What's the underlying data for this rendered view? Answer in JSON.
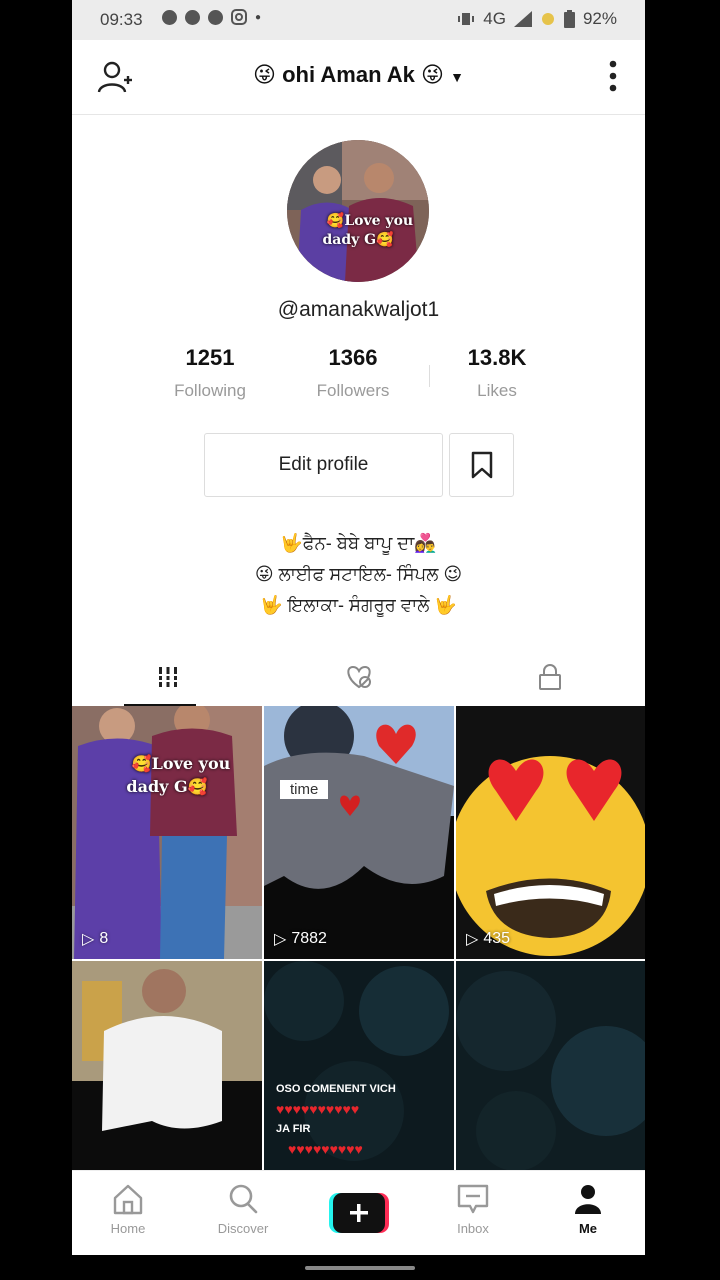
{
  "status_bar": {
    "time": "09:33",
    "network": "4G",
    "battery": "92%"
  },
  "header": {
    "title_prefix": "😜",
    "title": "ohi Aman Ak",
    "title_suffix": "😜"
  },
  "profile": {
    "avatar_caption_line1": "🥰Love you",
    "avatar_caption_line2": "dady G🥰",
    "handle": "@amanakwaljot1",
    "stats": [
      {
        "value": "1251",
        "label": "Following"
      },
      {
        "value": "1366",
        "label": "Followers"
      },
      {
        "value": "13.8K",
        "label": "Likes"
      }
    ],
    "edit_label": "Edit profile",
    "bio": [
      "🤟ਫੈਨ- ਬੇਬੇ ਬਾਪੂ ਦਾ👩‍❤️‍👨",
      "😜 ਲਾਈਫ ਸਟਾਇਲ- ਸਿੰਪਲ 😉",
      "🤟 ਇਲਾਕਾ- ਸੰਗਰੂਰ ਵਾਲੇ 🤟"
    ]
  },
  "tabs": [
    {
      "icon": "grid-icon"
    },
    {
      "icon": "liked-hidden-icon"
    },
    {
      "icon": "lock-icon"
    }
  ],
  "videos": [
    {
      "plays": "8",
      "caption_line1": "🥰Love you",
      "caption_line2": "dady G🥰"
    },
    {
      "plays": "7882",
      "caption": "time"
    },
    {
      "plays": "435"
    },
    {
      "plays": ""
    },
    {
      "plays": "",
      "caption_line1": "OSO COMENENT VICH",
      "caption_line2": "JA FIR"
    },
    {
      "plays": ""
    }
  ],
  "nav": [
    {
      "label": "Home",
      "icon": "home-icon"
    },
    {
      "label": "Discover",
      "icon": "search-icon"
    },
    {
      "label": "",
      "icon": "plus-icon"
    },
    {
      "label": "Inbox",
      "icon": "inbox-icon"
    },
    {
      "label": "Me",
      "icon": "profile-icon"
    }
  ],
  "colors": {
    "accent_cyan": "#25f4ee",
    "accent_red": "#fe2c55",
    "text": "#111111",
    "muted": "#9a9a9a"
  }
}
